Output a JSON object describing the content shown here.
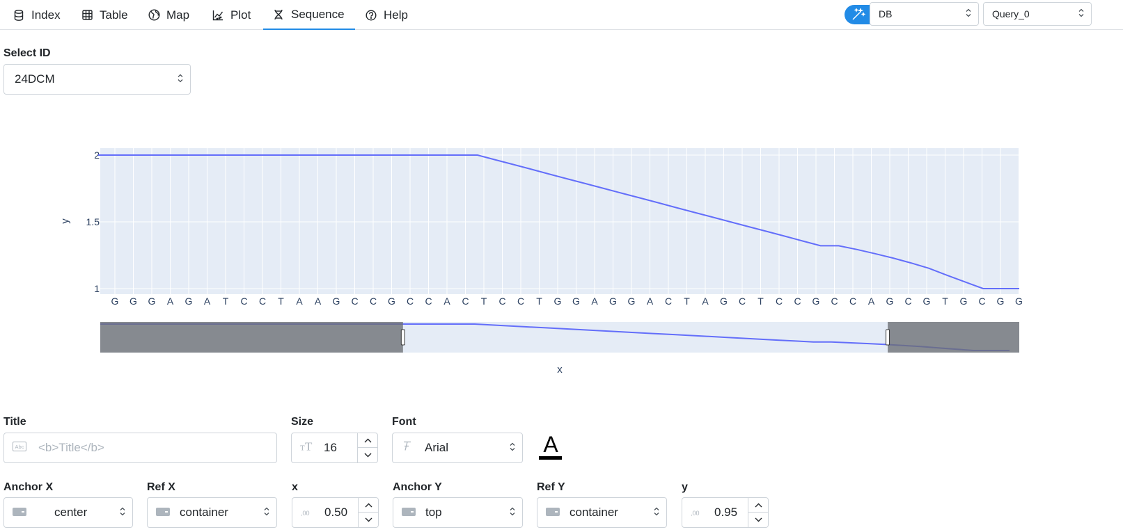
{
  "nav": {
    "tabs": [
      {
        "label": "Index",
        "icon": "database-icon"
      },
      {
        "label": "Table",
        "icon": "table-icon"
      },
      {
        "label": "Map",
        "icon": "globe-icon"
      },
      {
        "label": "Plot",
        "icon": "chart-line-icon"
      },
      {
        "label": "Sequence",
        "icon": "dna-icon",
        "active": true
      },
      {
        "label": "Help",
        "icon": "help-icon"
      }
    ],
    "db_select": "DB",
    "query_select": "Query_0"
  },
  "select_id": {
    "label": "Select ID",
    "value": "24DCM"
  },
  "chart_data": {
    "type": "line",
    "xlabel": "x",
    "ylabel": "y",
    "ylim": [
      1,
      2
    ],
    "yticks": [
      "1",
      "1.5",
      "2"
    ],
    "grid": true,
    "categories": [
      "G",
      "G",
      "G",
      "A",
      "G",
      "A",
      "T",
      "C",
      "C",
      "T",
      "A",
      "A",
      "G",
      "C",
      "C",
      "G",
      "C",
      "C",
      "A",
      "C",
      "T",
      "C",
      "C",
      "T",
      "G",
      "G",
      "A",
      "G",
      "G",
      "A",
      "C",
      "T",
      "A",
      "G",
      "C",
      "T",
      "C",
      "C",
      "G",
      "C",
      "C",
      "A",
      "G",
      "C",
      "G",
      "T",
      "G",
      "C",
      "G",
      "G"
    ],
    "series": [
      {
        "values": [
          2,
          2,
          2,
          2,
          2,
          2,
          2,
          2,
          2,
          2,
          2,
          2,
          2,
          2,
          2,
          2,
          2,
          2,
          2,
          2,
          2,
          2,
          1.964,
          1.929,
          1.893,
          1.857,
          1.821,
          1.786,
          1.75,
          1.714,
          1.679,
          1.643,
          1.607,
          1.571,
          1.536,
          1.5,
          1.464,
          1.429,
          1.393,
          1.357,
          1.321,
          1.321,
          1.293,
          1.262,
          1.229,
          1.192,
          1.152,
          1.1,
          1.05,
          1,
          1,
          1
        ],
        "color": "#636efa"
      }
    ],
    "rangeslider": {
      "start_index": 16.8,
      "end_index": 43.7
    }
  },
  "title_field": {
    "label": "Title",
    "placeholder": "<b>Title</b>"
  },
  "size_field": {
    "label": "Size",
    "value": "16"
  },
  "font_field": {
    "label": "Font",
    "value": "Arial"
  },
  "anchor_x": {
    "label": "Anchor X",
    "value": "center"
  },
  "ref_x": {
    "label": "Ref X",
    "value": "container"
  },
  "x_field": {
    "label": "x",
    "value": "0.50"
  },
  "anchor_y": {
    "label": "Anchor Y",
    "value": "top"
  },
  "ref_y": {
    "label": "Ref Y",
    "value": "container"
  },
  "y_field": {
    "label": "y",
    "value": "0.95"
  },
  "colors": {
    "accent": "#228be6",
    "trace": "#636efa",
    "plot_bg": "#e5ecf6"
  }
}
